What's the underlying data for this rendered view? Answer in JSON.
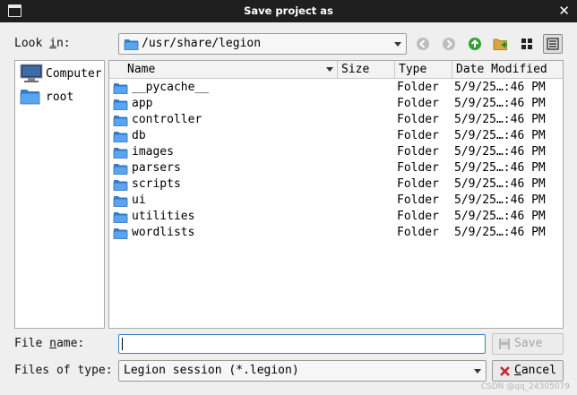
{
  "window": {
    "title": "Save project as"
  },
  "lookin": {
    "label_prefix": "Look ",
    "label_mnemonic": "i",
    "label_suffix": "n:",
    "path": "/usr/share/legion"
  },
  "toolbar": {
    "icons": [
      "back-arrow-icon",
      "forward-arrow-icon",
      "parent-directory-icon",
      "new-folder-icon",
      "list-view-icon",
      "detail-view-icon"
    ]
  },
  "sidebar": {
    "items": [
      {
        "label": "Computer",
        "icon": "computer-icon"
      },
      {
        "label": "root",
        "icon": "folder-icon"
      }
    ]
  },
  "columns": {
    "name": "Name",
    "size": "Size",
    "type": "Type",
    "date": "Date Modified"
  },
  "files": [
    {
      "name": "__pycache__",
      "type": "Folder",
      "date": "5/9/25…:46 PM"
    },
    {
      "name": "app",
      "type": "Folder",
      "date": "5/9/25…:46 PM"
    },
    {
      "name": "controller",
      "type": "Folder",
      "date": "5/9/25…:46 PM"
    },
    {
      "name": "db",
      "type": "Folder",
      "date": "5/9/25…:46 PM"
    },
    {
      "name": "images",
      "type": "Folder",
      "date": "5/9/25…:46 PM"
    },
    {
      "name": "parsers",
      "type": "Folder",
      "date": "5/9/25…:46 PM"
    },
    {
      "name": "scripts",
      "type": "Folder",
      "date": "5/9/25…:46 PM"
    },
    {
      "name": "ui",
      "type": "Folder",
      "date": "5/9/25…:46 PM"
    },
    {
      "name": "utilities",
      "type": "Folder",
      "date": "5/9/25…:46 PM"
    },
    {
      "name": "wordlists",
      "type": "Folder",
      "date": "5/9/25…:46 PM"
    }
  ],
  "filename": {
    "label_prefix": "File ",
    "label_mnemonic": "n",
    "label_suffix": "ame:",
    "value": ""
  },
  "filetype": {
    "label": "Files of type:",
    "selected": "Legion session (*.legion)"
  },
  "buttons": {
    "save": "Save",
    "cancel_mnemonic": "C",
    "cancel_rest": "ancel"
  },
  "watermark": "CSDN @qq_24305079"
}
